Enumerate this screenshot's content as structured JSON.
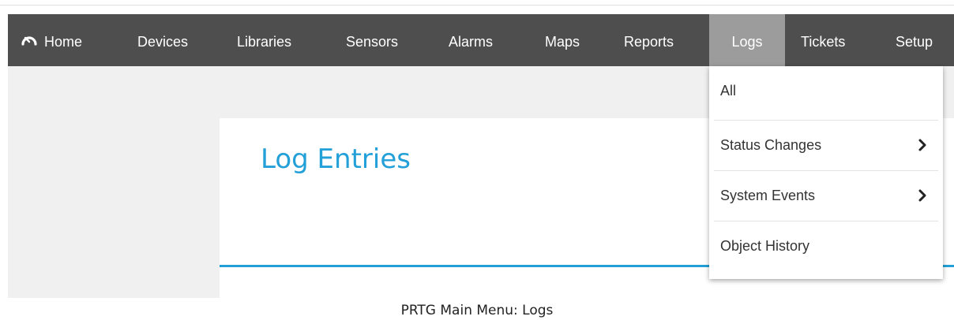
{
  "nav": {
    "home": "Home",
    "devices": "Devices",
    "libraries": "Libraries",
    "sensors": "Sensors",
    "alarms": "Alarms",
    "maps": "Maps",
    "reports": "Reports",
    "logs": "Logs",
    "tickets": "Tickets",
    "setup": "Setup",
    "active_item": "Logs",
    "home_icon": "gauge-icon"
  },
  "page": {
    "title": "Log Entries"
  },
  "logs_menu": {
    "items": [
      {
        "label": "All",
        "has_submenu": false
      },
      {
        "label": "Status Changes",
        "has_submenu": true,
        "icon": "chevron-right-icon"
      },
      {
        "label": "System Events",
        "has_submenu": true,
        "icon": "chevron-right-icon"
      },
      {
        "label": "Object History",
        "has_submenu": false
      }
    ]
  },
  "caption": "PRTG Main Menu: Logs",
  "colors": {
    "navbar": "#4e4e4e",
    "active_tab": "#9c9c9c",
    "title_blue": "#23a0d8",
    "page_background": "#f0f0f0"
  }
}
